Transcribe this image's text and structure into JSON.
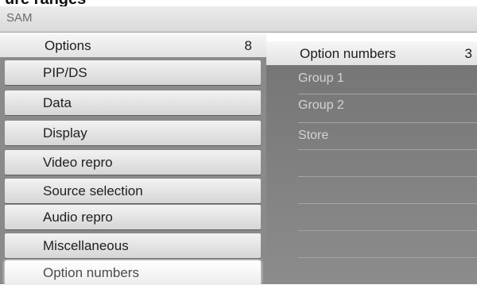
{
  "page_heading_fragment": "ure ranges",
  "window": {
    "title": "SAM"
  },
  "options_panel": {
    "header_label": "Options",
    "header_count": "8",
    "items": [
      {
        "label": "PIP/DS"
      },
      {
        "label": "Data"
      },
      {
        "label": "Display"
      },
      {
        "label": "Video repro"
      },
      {
        "label": "Source selection"
      },
      {
        "label": "Audio repro"
      },
      {
        "label": "Miscellaneous"
      },
      {
        "label": "Option numbers",
        "selected": true
      }
    ]
  },
  "submenu_panel": {
    "header_label": "Option numbers",
    "header_count": "3",
    "items": [
      {
        "label": "Group 1"
      },
      {
        "label": "Group 2"
      },
      {
        "label": "Store"
      }
    ]
  }
}
